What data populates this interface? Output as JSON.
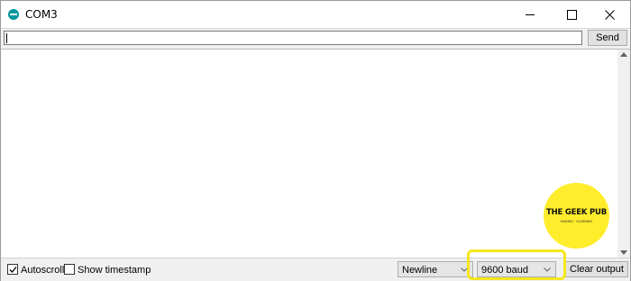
{
  "window": {
    "title": "COM3",
    "app_icon": "arduino-icon",
    "controls": [
      "minimize-icon",
      "maximize-icon",
      "close-icon"
    ]
  },
  "input_row": {
    "input_value": "",
    "send_label": "Send"
  },
  "output": {
    "text": ""
  },
  "watermark": {
    "title": "THE GEEK PUB",
    "subtitle": "MAKING · LEARNING",
    "color": "#ffed2b"
  },
  "bottom_bar": {
    "autoscroll_label": "Autoscroll",
    "autoscroll_checked": true,
    "timestamp_label": "Show timestamp",
    "timestamp_checked": false,
    "line_ending": "Newline",
    "baud_rate": "9600 baud",
    "clear_label": "Clear output",
    "highlight_color": "#f5e61e"
  }
}
